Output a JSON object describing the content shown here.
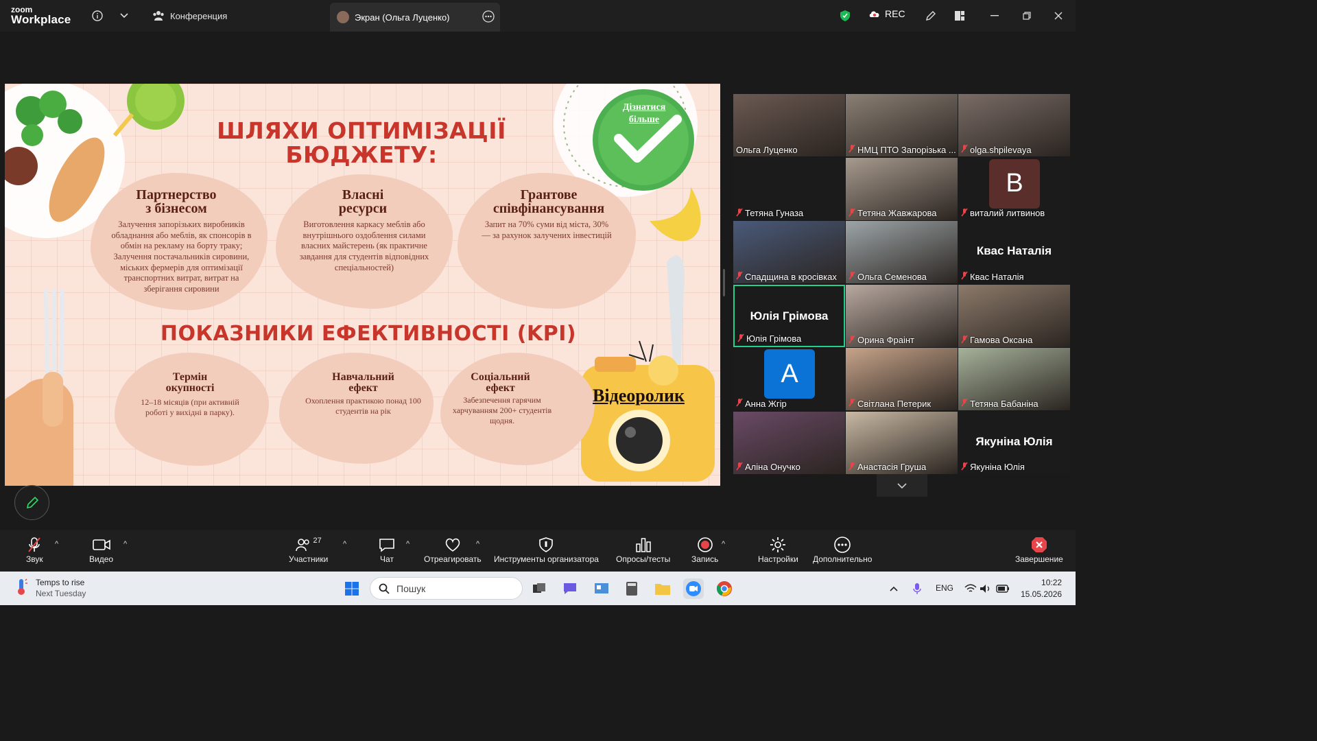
{
  "app": {
    "logo_line1": "zoom",
    "logo_line2": "Workplace"
  },
  "tabs": {
    "conference": "Конференция",
    "screen": "Экран (Ольга Луценко)"
  },
  "status": {
    "rec": "REC"
  },
  "slide": {
    "heading1_line1": "ШЛЯХИ ОПТИМІЗАЦІЇ",
    "heading1_line2": "БЮДЖЕТУ:",
    "learn_more_line1": "Дізнатися",
    "learn_more_line2": "більше",
    "cards_top": [
      {
        "title1": "Партнерство",
        "title2": "з бізнесом",
        "text": "Залучення запорізьких виробників обладнання або меблів, як спонсорів в обмін на рекламу на борту траку; Залучення постачальників сировини, міських фермерів для оптимізації транспортних витрат, витрат на зберігання сировини"
      },
      {
        "title1": "Власні",
        "title2": "ресурси",
        "text": "Виготовлення каркасу меблів або внутрішнього оздоблення силами власних майстерень (як практичне завдання для студентів відповідних спеціальностей)"
      },
      {
        "title1": "Грантове",
        "title2": "співфінансування",
        "text": "Запит на 70% суми від міста, 30% — за рахунок залучених інвестицій"
      }
    ],
    "heading2": "ПОКАЗНИКИ ЕФЕКТИВНОСТІ (KPI)",
    "cards_bottom": [
      {
        "title1": "Термін",
        "title2": "окупності",
        "text": "12–18 місяців (при активній роботі у вихідні в парку)."
      },
      {
        "title1": "Навчальний",
        "title2": "ефект",
        "text": "Охоплення практикою понад 100 студентів на рік"
      },
      {
        "title1": "Соціальний",
        "title2": "ефект",
        "text": "Забезпечення гарячим харчуванням 200+ студентів щодня."
      }
    ],
    "video_label": "Відеоролик"
  },
  "participants": [
    {
      "name": "Ольга Луценко",
      "muted": false,
      "kind": "video",
      "bg": "#6b5a52"
    },
    {
      "name": "НМЦ ПТО Запорізька ...",
      "muted": true,
      "kind": "video",
      "bg": "#8a7f74"
    },
    {
      "name": "olga.shpilevaya",
      "muted": true,
      "kind": "video",
      "bg": "#7a6c66"
    },
    {
      "name": "Тетяна Гуназа",
      "muted": true,
      "kind": "blank"
    },
    {
      "name": "Тетяна Жавжарова",
      "muted": true,
      "kind": "video",
      "bg": "#a79a8e"
    },
    {
      "name": "виталий литвинов",
      "muted": true,
      "kind": "avatar",
      "letter": "В",
      "avbg": "#5a2e2a"
    },
    {
      "name": "Спадщина в кросівках",
      "muted": true,
      "kind": "video",
      "bg": "#4a5a7a"
    },
    {
      "name": "Ольга Семенова",
      "muted": true,
      "kind": "video",
      "bg": "#9da5a8"
    },
    {
      "name": "Квас Наталія",
      "muted": true,
      "kind": "text",
      "big": "Квас Наталія"
    },
    {
      "name": "Юлія Грімова",
      "muted": true,
      "kind": "text",
      "big": "Юлія Грімова",
      "active": true
    },
    {
      "name": "Орина Фраінт",
      "muted": true,
      "kind": "video",
      "bg": "#b8a9a0"
    },
    {
      "name": "Гамова Оксана",
      "muted": true,
      "kind": "video",
      "bg": "#8c7a6a"
    },
    {
      "name": "Анна Жгір",
      "muted": true,
      "kind": "avatar",
      "letter": "A",
      "avbg": "#0b72d6"
    },
    {
      "name": "Світлана Петерик",
      "muted": true,
      "kind": "video",
      "bg": "#c7a48a"
    },
    {
      "name": "Тетяна Бабаніна",
      "muted": true,
      "kind": "video",
      "bg": "#a6b29a"
    },
    {
      "name": "Аліна Онучко",
      "muted": true,
      "kind": "video",
      "bg": "#6a4a66"
    },
    {
      "name": "Анастасія Груша",
      "muted": true,
      "kind": "video",
      "bg": "#c9b9a4"
    },
    {
      "name": "Якуніна Юлія",
      "muted": true,
      "kind": "text",
      "big": "Якуніна Юлія"
    }
  ],
  "toolbar": {
    "audio": "Звук",
    "video": "Видео",
    "participants": "Участники",
    "participants_count": "27",
    "chat": "Чат",
    "react": "Отреагировать",
    "host_tools": "Инструменты организатора",
    "polls": "Опросы/тесты",
    "record": "Запись",
    "settings": "Настройки",
    "more": "Дополнительно",
    "end": "Завершение"
  },
  "taskbar": {
    "weather_line1": "Temps to rise",
    "weather_line2": "Next Tuesday",
    "search_placeholder": "Пошук",
    "lang": "ENG",
    "time": "10:22",
    "date": "15.05.2026"
  }
}
